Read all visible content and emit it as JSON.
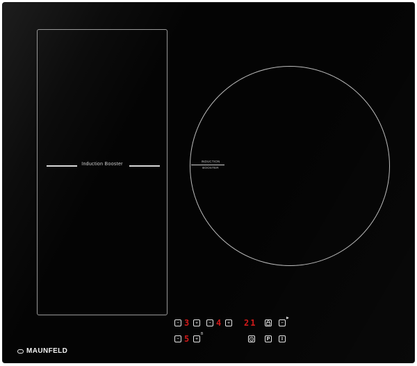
{
  "brand": {
    "name": "MAUNFELD",
    "icon": "maunfeld-logo-icon"
  },
  "zones": {
    "left": {
      "label": "Induction Booster"
    },
    "right": {
      "label_line1": "INDUCTION",
      "label_line2": "BOOSTER"
    }
  },
  "controls": {
    "top_row": {
      "minus1": "−",
      "level1": "3",
      "plus1": "+",
      "minus2": "−",
      "level2": "4",
      "plus2": "+",
      "timer": "21",
      "keylock_icon": "keylock-icon",
      "minus3": "−",
      "play_icon": "play-icon"
    },
    "bottom_row": {
      "minus1": "−",
      "level1": "5",
      "plus1": "+",
      "booster_mark": "B",
      "timer_icon": "timer-icon",
      "pause_key": "P",
      "power_key": "I"
    }
  },
  "colors": {
    "glass": "#040404",
    "outline": "#bdbdbd",
    "display_red": "#d11a1a"
  }
}
